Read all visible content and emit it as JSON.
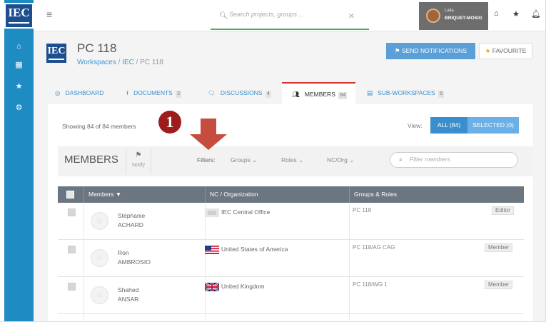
{
  "logo": {
    "text": "IEC"
  },
  "sidebar": {
    "items": [
      {
        "icon": "home-icon"
      },
      {
        "icon": "calendar-icon"
      },
      {
        "icon": "star-icon"
      },
      {
        "icon": "gear-icon"
      }
    ]
  },
  "header": {
    "search_placeholder": "Search projects, groups ...",
    "user_first": "Laila",
    "user_last": "BRIQUET-MOSIG"
  },
  "page": {
    "title": "PC 118",
    "breadcrumb": [
      "Workspaces",
      "IEC",
      "PC 118"
    ],
    "send_notifications": "SEND NOTIFICATIONS",
    "favourite": "FAVOURITE"
  },
  "tabs": [
    {
      "label": "DASHBOARD",
      "count": ""
    },
    {
      "label": "DOCUMENTS",
      "count": "2"
    },
    {
      "label": "DISCUSSIONS",
      "count": "4"
    },
    {
      "label": "MEMBERS",
      "count": "84"
    },
    {
      "label": "SUB-WORKSPACES",
      "count": "5"
    }
  ],
  "members": {
    "showing": "Showing 84 of 84 members",
    "view_label": "View:",
    "view_all": "ALL (84)",
    "view_selected": "SELECTED (0)",
    "section_title": "MEMBERS",
    "notify_label": "Notify",
    "filters_label": "Filters:",
    "filter_groups": "Groups",
    "filter_roles": "Roles",
    "filter_ncorg": "NC/Org",
    "filter_placeholder": "Filter members",
    "columns": {
      "members": "Members ▼",
      "org": "NC / Organization",
      "groups": "Groups & Roles"
    },
    "rows": [
      {
        "first": "Stéphanie",
        "last": "ACHARD",
        "org": "IEC Central Office",
        "group": "PC 118",
        "role": "Editor"
      },
      {
        "first": "Ron",
        "last": "AMBROSIO",
        "org": "United States of America",
        "group": "PC 118/AG CAG",
        "role": "Member"
      },
      {
        "first": "Shahed",
        "last": "ANSAR",
        "org": "United Kingdom",
        "group": "PC 118/WG 1",
        "role": "Member"
      }
    ]
  },
  "annotation": {
    "number": "1"
  }
}
